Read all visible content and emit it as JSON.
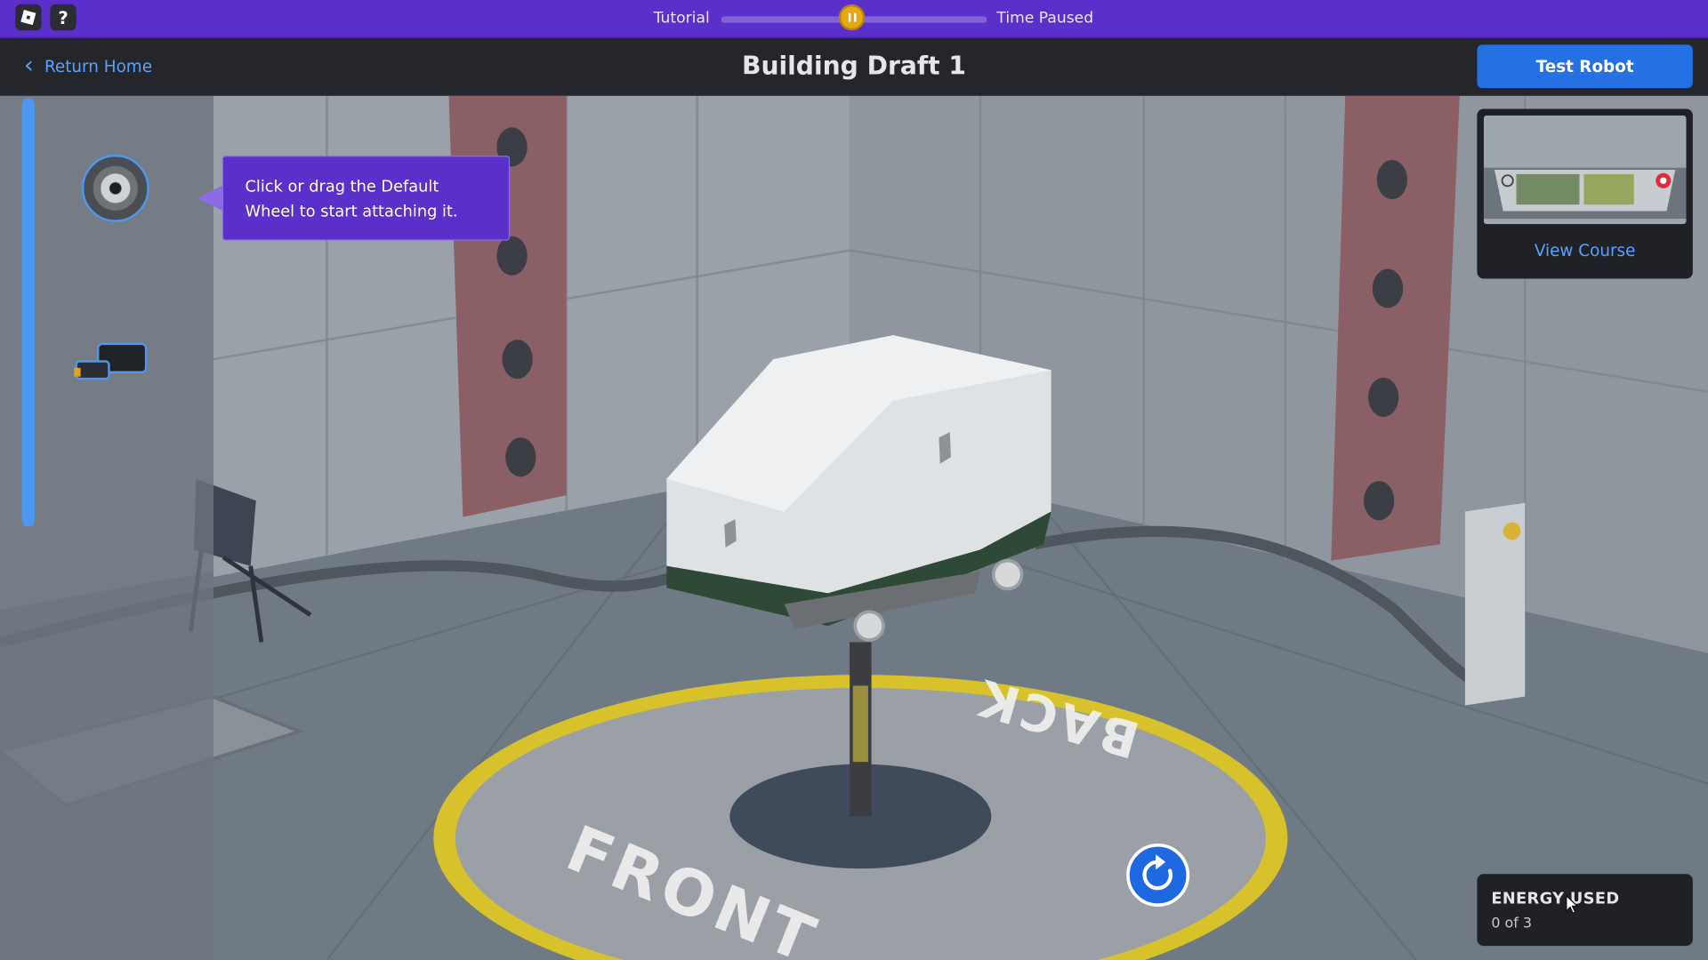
{
  "topbar": {
    "logo_icon": "roblox-logo-icon",
    "help_label": "?",
    "tutorial_label": "Tutorial",
    "status_label": "Time Paused",
    "progress": 0.5,
    "pause_icon": "pause-icon"
  },
  "header": {
    "back_label": "Return Home",
    "title": "Building Draft 1",
    "test_button": "Test Robot"
  },
  "sidebar": {
    "parts": [
      {
        "name": "Default Wheel",
        "icon": "wheel-icon"
      },
      {
        "name": "Motor",
        "icon": "motor-icon"
      }
    ]
  },
  "tooltip": {
    "text": "Click or drag the Default Wheel to start attaching it."
  },
  "course": {
    "label": "View Course"
  },
  "energy": {
    "title": "ENERGY USED",
    "value": "0 of 3"
  },
  "scene": {
    "front_label": "FRONT",
    "back_label": "BACK"
  },
  "colors": {
    "topbar": "#5b2fc9",
    "header": "#24262c",
    "accent_blue": "#2570e3",
    "link_blue": "#5aa2ff",
    "knob": "#e6a814"
  }
}
